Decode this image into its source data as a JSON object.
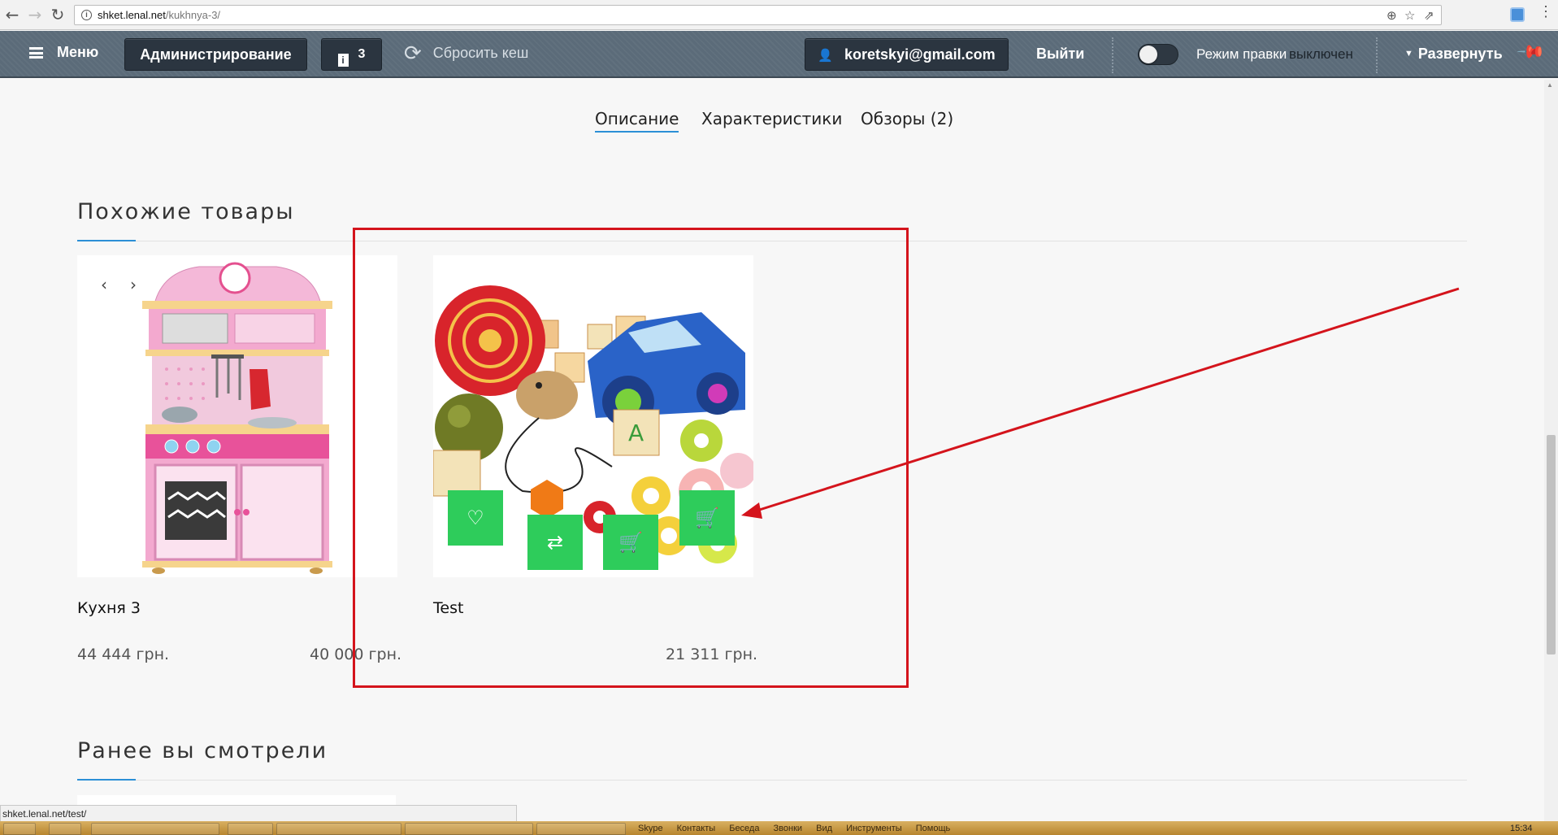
{
  "browser": {
    "url_host": "shket.lenal.net",
    "url_path": "/kukhnya-3/"
  },
  "admin_panel": {
    "menu_label": "Меню",
    "admin_label": "Администрирование",
    "notifications_count": "3",
    "reset_cache_label": "Сбросить кеш",
    "user_email": "koretskyi@gmail.com",
    "logout_label": "Выйти",
    "edit_mode_label": "Режим правки",
    "edit_mode_status": "выключен",
    "expand_label": "Развернуть"
  },
  "tabs": [
    {
      "label": "Описание",
      "active": true
    },
    {
      "label": "Характеристики",
      "active": false
    },
    {
      "label": "Обзоры (2)",
      "active": false
    }
  ],
  "similar_products": {
    "title": "Похожие товары",
    "items": [
      {
        "name": "Кухня 3",
        "old_price": "44 444 грн.",
        "price": "40 000 грн."
      },
      {
        "name": "Test",
        "price": "21 311 грн."
      }
    ]
  },
  "recently_viewed": {
    "title": "Ранее вы смотрели"
  },
  "status_bar": {
    "hover_url": "shket.lenal.net/test/"
  },
  "taskbar": {
    "menu_items": [
      "Skype",
      "Контакты",
      "Беседа",
      "Звонки",
      "Вид",
      "Инструменты",
      "Помощь"
    ],
    "clock": "15:34"
  },
  "colors": {
    "action_green": "#2ecc5b",
    "annotation_red": "#d4141c",
    "accent_blue": "#2b8fd6",
    "admin_bg": "#5b6b79"
  }
}
